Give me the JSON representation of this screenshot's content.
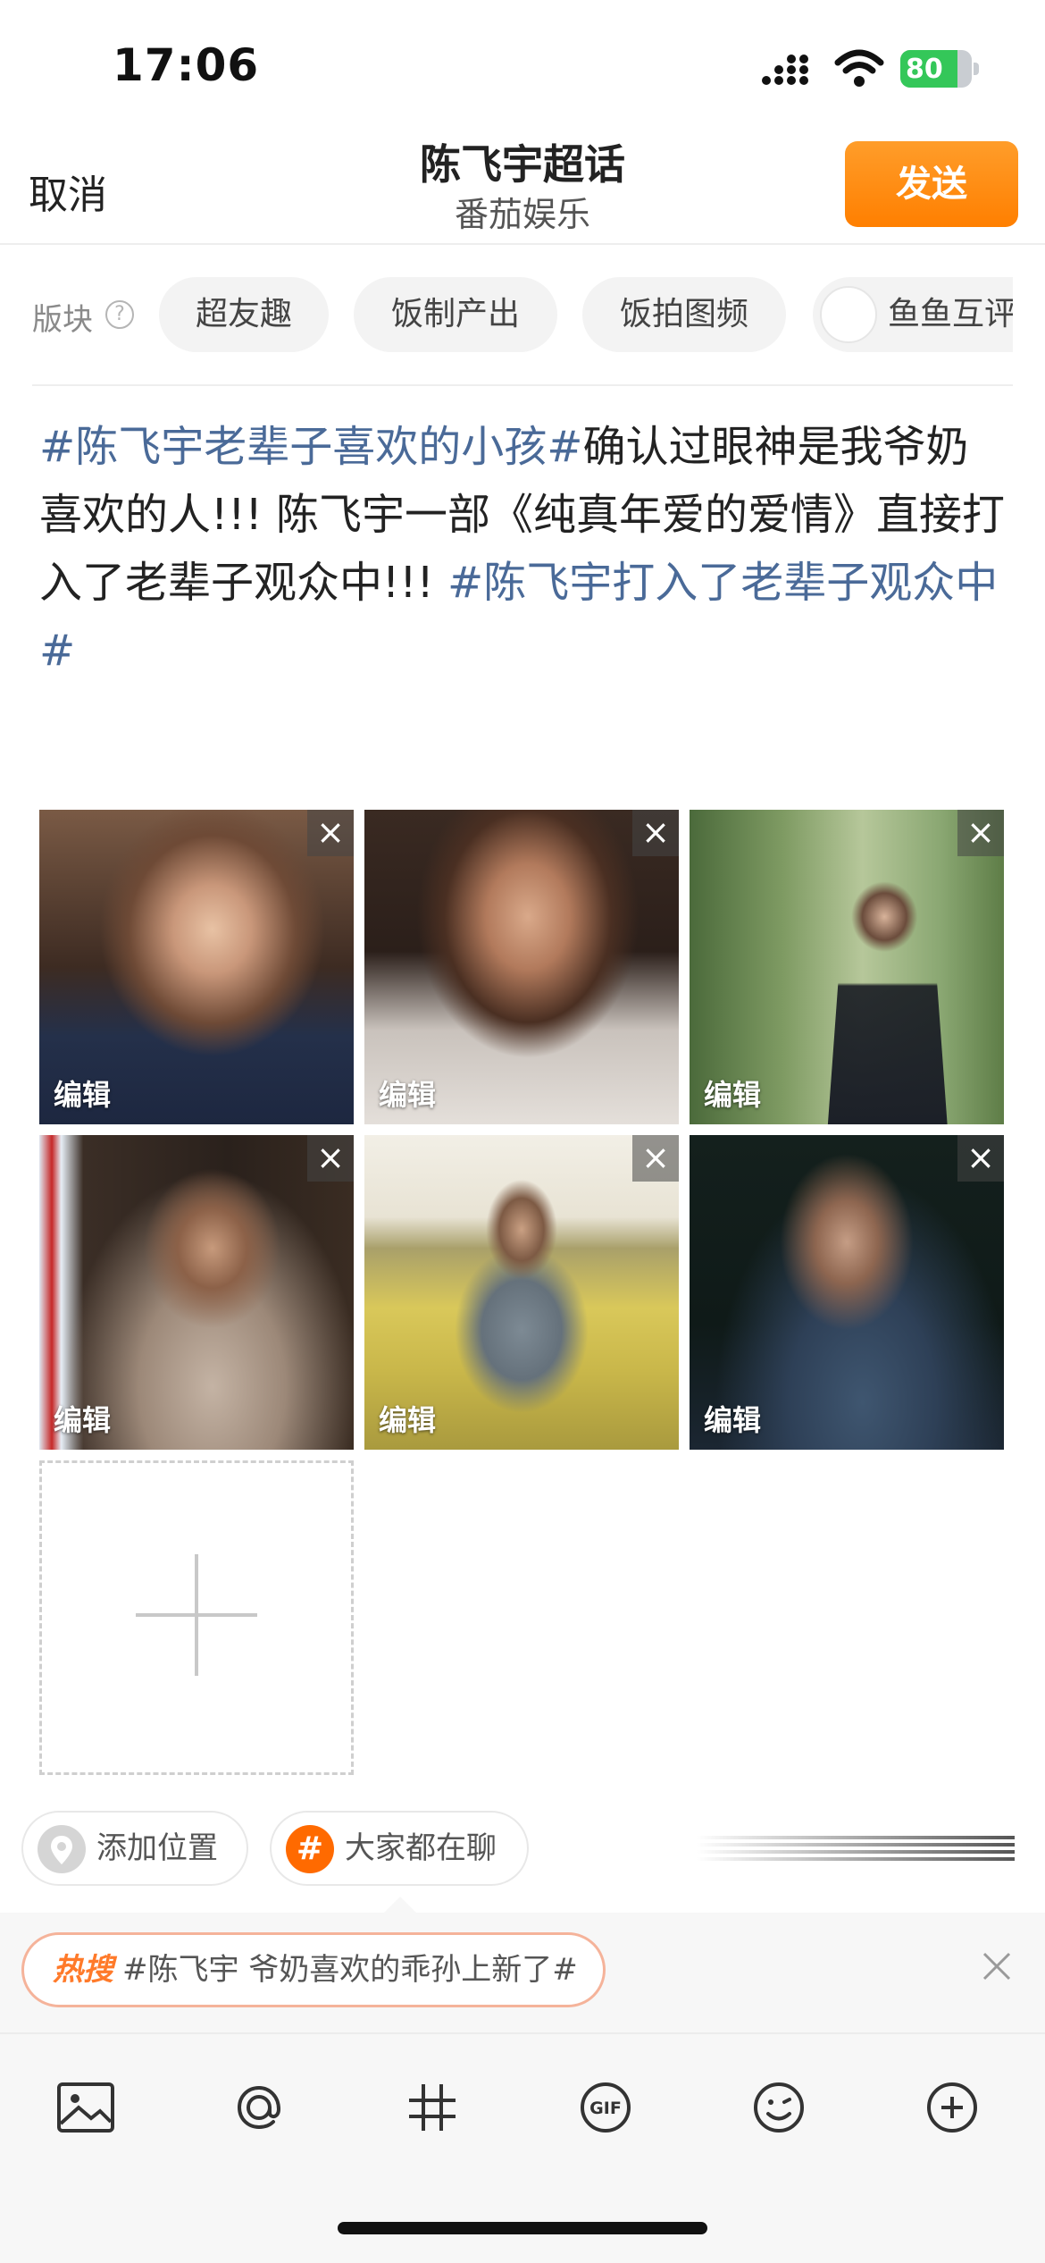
{
  "status_bar": {
    "time": "17:06",
    "battery_level": "80",
    "battery_fraction": 0.8
  },
  "header": {
    "cancel_label": "取消",
    "title": "陈飞宇超话",
    "subtitle": "番茄娱乐",
    "send_label": "发送"
  },
  "sections": {
    "label": "版块",
    "chips": [
      "超友趣",
      "饭制产出",
      "饭拍图频",
      "鱼鱼互评"
    ]
  },
  "post": {
    "segments": [
      {
        "text": "#陈飞宇老辈子喜欢的小孩#",
        "type": "hashtag"
      },
      {
        "text": "确认过眼神是我爷奶喜欢的人!!! 陈飞宇一部《纯真年爱的爱情》直接打入了老辈子观众中!!! ",
        "type": "text"
      },
      {
        "text": "#陈飞宇打入了老辈子观众中#",
        "type": "hashtag"
      }
    ]
  },
  "images": {
    "edit_label": "编辑",
    "close_icon": "close-icon",
    "count": 6
  },
  "location": {
    "label": "添加位置",
    "icon": "location-pin-icon"
  },
  "topic": {
    "label": "大家都在聊",
    "icon": "hashtag-icon"
  },
  "hot_search": {
    "tag": "热搜",
    "text": "#陈飞宇 爷奶喜欢的乖孙上新了#"
  },
  "toolbar": {
    "tools": [
      "image-icon",
      "mention-icon",
      "hashtag-icon",
      "gif-icon",
      "emoji-icon",
      "more-icon"
    ]
  },
  "colors": {
    "accent_orange": "#ff8a00",
    "hashtag_blue": "#4a6a98",
    "hot_search_orange": "#ff7a2a",
    "battery_green": "#34c759"
  }
}
